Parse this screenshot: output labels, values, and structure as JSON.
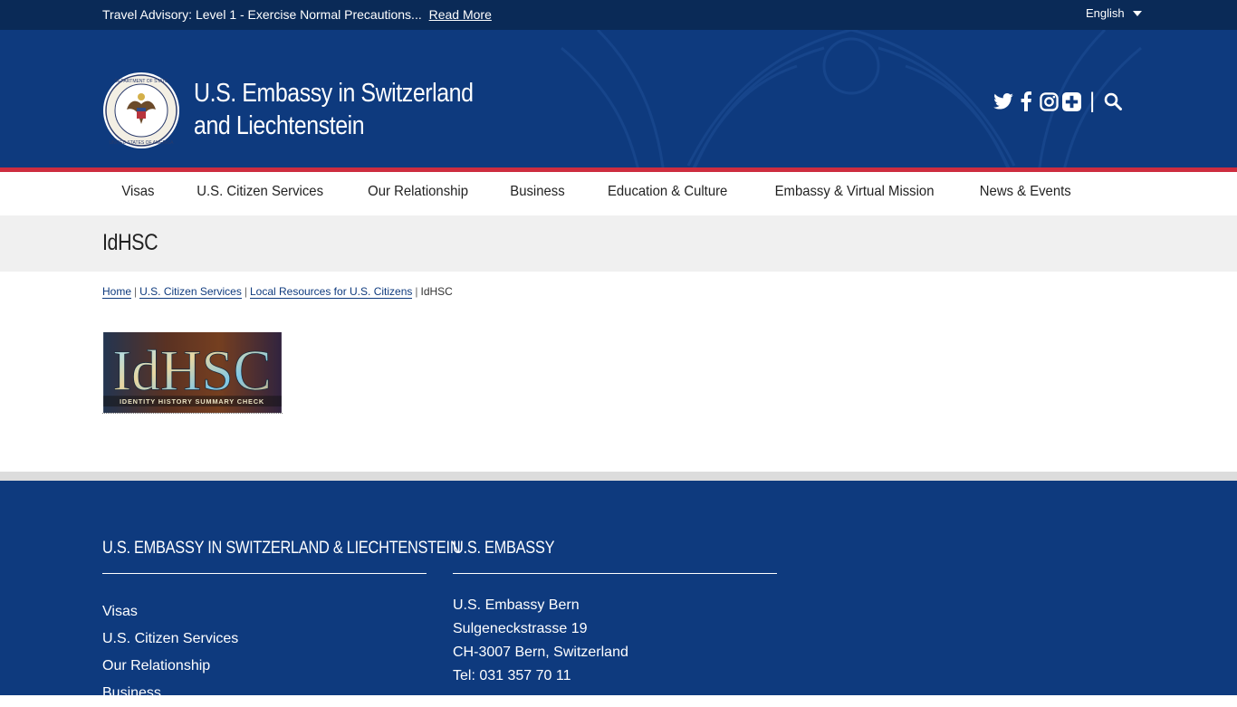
{
  "advisory": {
    "text": "Travel Advisory: Level 1 - Exercise Normal Precautions...",
    "link": "Read More"
  },
  "language": {
    "selected": "English"
  },
  "site": {
    "title_line1": "U.S. Embassy in Switzerland",
    "title_line2": "and Liechtenstein"
  },
  "social": {
    "icons": [
      "twitter-icon",
      "facebook-icon",
      "instagram-icon",
      "plus-icon",
      "search-icon"
    ],
    "separator": "|"
  },
  "nav": {
    "items": [
      "Visas",
      "U.S. Citizen Services",
      "Our Relationship",
      "Business",
      "Education & Culture",
      "Embassy & Virtual Mission",
      "News & Events"
    ]
  },
  "page": {
    "title": "IdHSC"
  },
  "breadcrumb": {
    "home": "Home",
    "level1": "U.S. Citizen Services",
    "level2": "Local Resources for U.S. Citizens",
    "current": "IdHSC",
    "separator": "|"
  },
  "image": {
    "big_text": "IdHSC",
    "caption": "IDENTITY HISTORY SUMMARY CHECK"
  },
  "footer": {
    "col1": {
      "heading": "U.S. EMBASSY IN SWITZERLAND & LIECHTENSTEIN",
      "links": [
        "Visas",
        "U.S. Citizen Services",
        "Our Relationship",
        "Business"
      ]
    },
    "col2": {
      "heading": "U.S. EMBASSY",
      "lines": [
        "U.S. Embassy Bern",
        "Sulgeneckstrasse 19",
        "CH-3007 Bern, Switzerland",
        "Tel: 031 357 70 11"
      ]
    }
  },
  "colors": {
    "advisory_bg": "#0a2a57",
    "header_bg": "#0e3a7e",
    "accent_red": "#cd2d3f",
    "title_band_bg": "#f0f0f0"
  }
}
